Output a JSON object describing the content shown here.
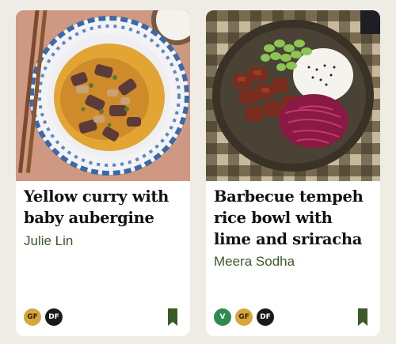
{
  "recipes": [
    {
      "title": "Yellow curry with baby aubergine",
      "author": "Julie Lin",
      "badges": [
        "GF",
        "DF"
      ],
      "image": "yellow-curry-photo"
    },
    {
      "title": "Barbecue tempeh rice bowl with lime and sriracha",
      "author": "Meera Sodha",
      "badges": [
        "V",
        "GF",
        "DF"
      ],
      "image": "tempeh-rice-bowl-photo"
    }
  ],
  "icons": {
    "bookmark": "bookmark-icon"
  },
  "colors": {
    "author": "#3c5a2c",
    "gluten_free_badge": "#d8a63b",
    "dairy_free_badge": "#1a1a1a",
    "vegan_badge": "#2e8a4e",
    "bookmark": "#3b5a2a"
  }
}
